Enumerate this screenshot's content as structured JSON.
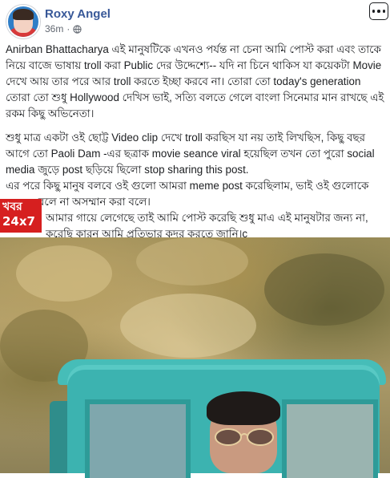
{
  "post": {
    "author_name": "Roxy Angel",
    "time": "36m",
    "dot": "·",
    "privacy_icon": "globe-icon",
    "more_icon": "more-options-icon",
    "paragraphs": [
      "Anirban Bhattacharya এই মানুষটিকে এখনও পর্যন্ত না চেনা আমি পোস্ট করা এবং তাকে নিয়ে বাজে ভাষায় troll করা Public দের উদ্দেশ্যে-- যদি না চিনে থাকিস যা কয়েকটা Movie দেখে আয় তার পরে আর troll করতে ইচ্ছা করবে না। তোরা তো today's generation তোরা তো শুধু Hollywood দেখিস ভাই, সত্যি বলতে গেলে বাংলা সিনেমার মান রাখছে এই রকম কিছু অভিনেতা।",
      "শুধু মাত্র একটা ওই ছোট্ট Video clip দেখে troll করছিস যা নয় তাই লিখছিস, কিছু বছর আগে তো Paoli Dam -এর ছত্রাক movie seance viral হয়েছিল তখন তো পুরো social media জুড়ে post ছড়িয়ে ছিলো stop sharing this post.",
      "এর পরে কিছু মানুষ বলবে ওই গুলো আমরা meme post করেছিলাম, ভাই ওই গুলোকে meme বলে না অসম্মান করা বলে।",
      "আমার গায়ে লেগেছে তাই আমি পোস্ট করেছি শুধু মাএ এই মানুষটার জন্য না, করেছি কারন আমি প্রতিভার কদর করতে জানি।c"
    ]
  },
  "watermark": {
    "line1": "খবর",
    "line2": "24x7"
  },
  "colors": {
    "author_link": "#385898",
    "meta_text": "#616770",
    "watermark_bg": "#d61f1f",
    "truck": "#3cb3b0"
  }
}
